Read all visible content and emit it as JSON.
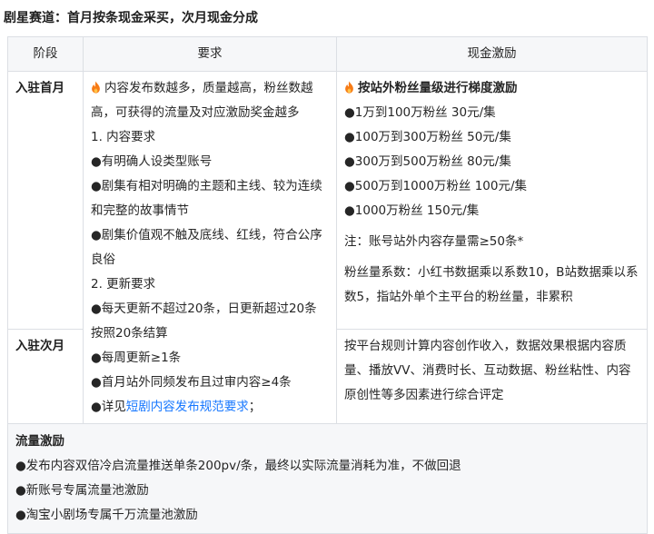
{
  "heading": "剧星赛道：首月按条现金采买，次月现金分成",
  "table": {
    "headers": {
      "stage": "阶段",
      "requirements": "要求",
      "cash": "现金激励"
    },
    "stage_first_month": "入驻首月",
    "stage_second_month": "入驻次月",
    "requirements": {
      "intro": "内容发布数越多，质量越高，粉丝数越高，可获得的流量及对应激励奖金越多",
      "section1_title": "1. 内容要求",
      "section1_items": [
        "●有明确人设类型账号",
        "●剧集有相对明确的主题和主线、较为连续和完整的故事情节",
        "●剧集价值观不触及底线、红线，符合公序良俗"
      ],
      "section2_title": "2. 更新要求",
      "section2_items": [
        "●每天更新不超过20条，日更新超过20条按照20条结算",
        "●每周更新≥1条",
        "●首月站外同频发布且过审内容≥4条"
      ],
      "detail_prefix": "●详见",
      "detail_link": "短剧内容发布规范要求",
      "detail_suffix": "；"
    },
    "cash_first_month": {
      "title": "按站外粉丝量级进行梯度激励",
      "tiers": [
        "●1万到100万粉丝 30元/集",
        "●100万到300万粉丝 50元/集",
        "●300万到500万粉丝 80元/集",
        "●500万到1000万粉丝 100元/集",
        "●1000万粉丝 150元/集"
      ],
      "note": "注：账号站外内容存量需≥50条*",
      "coefficient": "粉丝量系数：小红书数据乘以系数10，B站数据乘以系数5，指站外单个主平台的粉丝量，非累积"
    },
    "cash_second_month": "按平台规则计算内容创作收入，数据效果根据内容质量、播放VV、消费时长、互动数据、粉丝粘性、内容原创性等多因素进行综合评定"
  },
  "traffic": {
    "title": "流量激励",
    "items": [
      "●发布内容双倍冷启流量推送单条200pv/条，最终以实际流量消耗为准，不做回退",
      "●新账号专属流量池激励",
      "●淘宝小剧场专属千万流量池激励"
    ]
  },
  "icons": {
    "fire": "fire-icon"
  },
  "colors": {
    "link": "#1677ff",
    "header_bg": "#f6f7f9",
    "border": "#dcdfe4",
    "fire": "#f77b16"
  }
}
